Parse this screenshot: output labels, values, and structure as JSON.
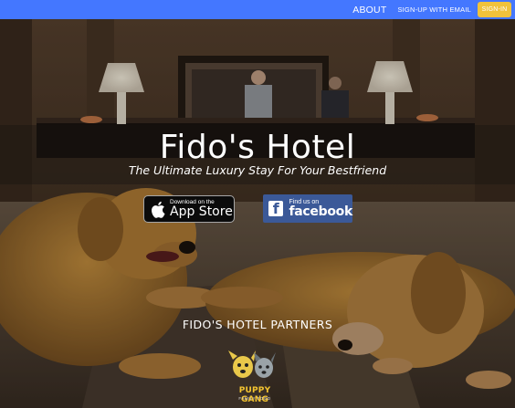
{
  "nav": {
    "about_label": "ABOUT",
    "signup_label": "SIGN-UP WITH EMAIL",
    "signin_label": "SIGN-IN",
    "bar_color": "#4477ff",
    "signin_color": "#f1c23b"
  },
  "hero": {
    "title": "Fido's Hotel",
    "subtitle": "The Ultimate Luxury Stay For Your Bestfriend",
    "background": "hotel-lobby-with-golden-retrievers-photo"
  },
  "badges": {
    "appstore": {
      "small": "Download on the",
      "big": "App Store",
      "icon": "apple-icon"
    },
    "facebook": {
      "small": "Find us on",
      "big": "facebook",
      "icon": "facebook-icon",
      "color": "#3b5998"
    }
  },
  "partners": {
    "heading": "FIDO'S HOTEL PARTNERS",
    "items": [
      {
        "name": "PUPPY GANG",
        "tagline": "FAMILY FOOD",
        "logo": "puppy-gang-logo"
      }
    ]
  }
}
